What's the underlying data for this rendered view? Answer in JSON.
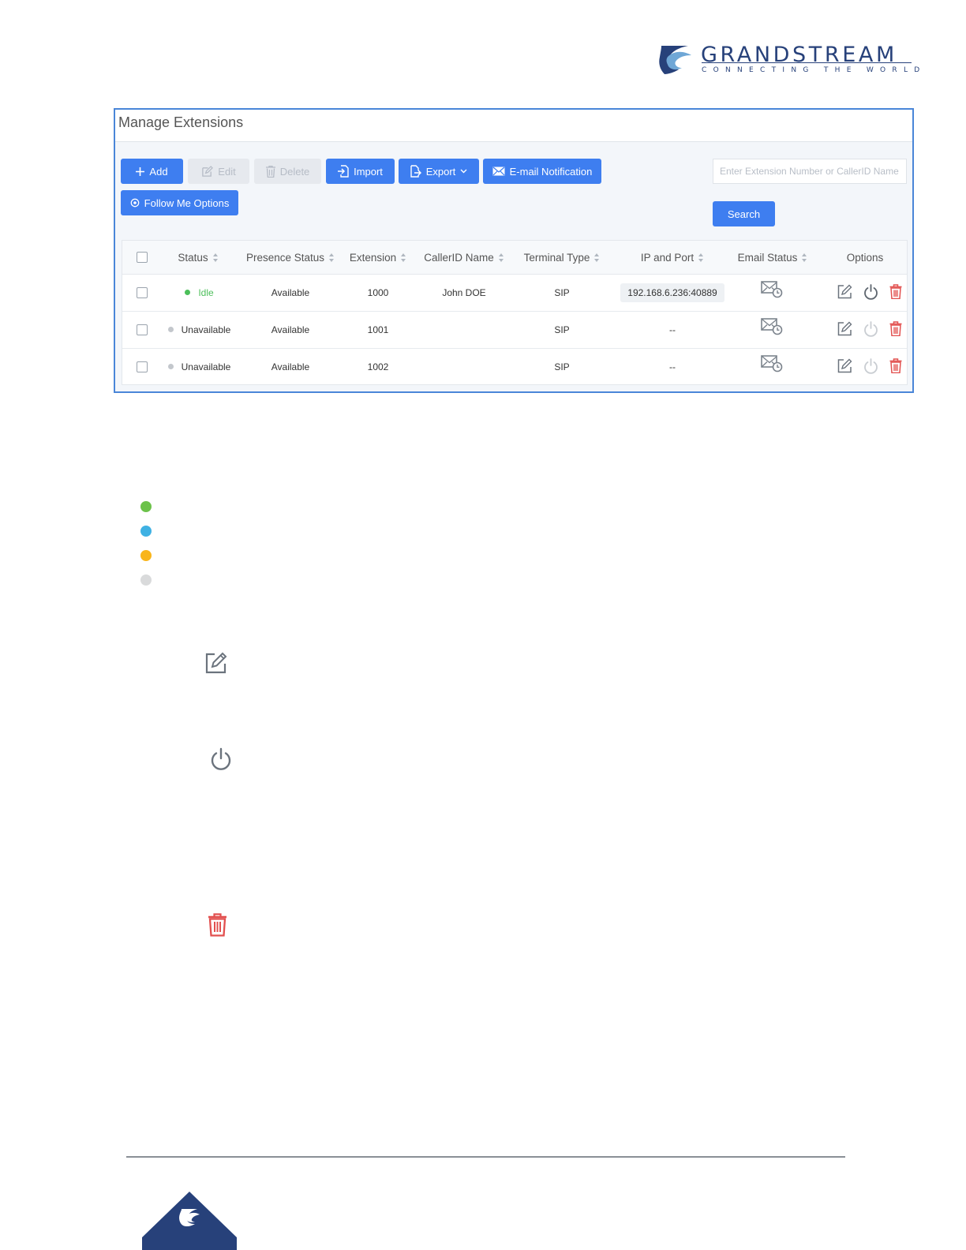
{
  "logo": {
    "name": "GRANDSTREAM",
    "tagline": "CONNECTING THE WORLD"
  },
  "panel": {
    "title": "Manage Extensions",
    "toolbar": {
      "add": "Add",
      "edit": "Edit",
      "delete": "Delete",
      "import": "Import",
      "export": "Export",
      "email": "E-mail Notification",
      "follow_me": "Follow Me Options",
      "search_button": "Search",
      "search_placeholder": "Enter Extension Number or CallerID Name"
    },
    "table": {
      "headers": {
        "status": "Status",
        "presence": "Presence Status",
        "extension": "Extension",
        "callerid": "CallerID Name",
        "terminal": "Terminal Type",
        "ip": "IP and Port",
        "email": "Email Status",
        "options": "Options"
      },
      "rows": [
        {
          "status": "Idle",
          "status_color": "#4cbf5a",
          "presence": "Available",
          "extension": "1000",
          "callerid": "John DOE",
          "terminal": "SIP",
          "ip": "192.168.6.236:40889"
        },
        {
          "status": "Unavailable",
          "status_color": "#c3c7cc",
          "presence": "Available",
          "extension": "1001",
          "callerid": "",
          "terminal": "SIP",
          "ip": "--"
        },
        {
          "status": "Unavailable",
          "status_color": "#c3c7cc",
          "presence": "Available",
          "extension": "1002",
          "callerid": "",
          "terminal": "SIP",
          "ip": "--"
        }
      ]
    }
  },
  "legend_colors": [
    "#6cc24a",
    "#3fb1e3",
    "#f9b51a",
    "#d9dadb"
  ],
  "colors": {
    "accent": "#3e7ef0",
    "delete_red": "#e2504f",
    "icon_gray": "#6b737d"
  }
}
